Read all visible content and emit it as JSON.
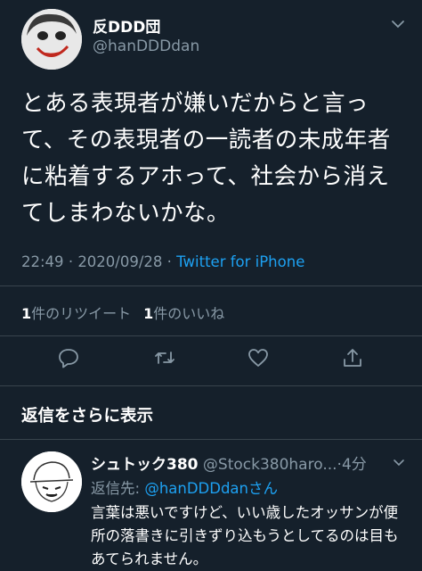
{
  "author": {
    "display_name": "反DDD団",
    "handle": "@hanDDDdan"
  },
  "tweet": {
    "text": "とある表現者が嫌いだからと言って、その表現者の一読者の未成年者に粘着するアホって、社会から消えてしまわないかな。",
    "time": "22:49",
    "date": "2020/09/28",
    "source": "Twitter for iPhone"
  },
  "stats": {
    "retweets_count": "1",
    "retweets_label": "件のリツイート",
    "likes_count": "1",
    "likes_label": "件のいいね"
  },
  "actions": {
    "reply_icon": "reply-icon",
    "retweet_icon": "retweet-icon",
    "like_icon": "heart-icon",
    "share_icon": "share-icon"
  },
  "more_replies_label": "返信をさらに表示",
  "reply": {
    "display_name": "シュトック380",
    "handle": "@Stock380haro...",
    "age": "4分",
    "replying_to_label": "返信先: ",
    "replying_to": "@hanDDDdanさん",
    "text": "言葉は悪いですけど、いい歳したオッサンが便所の落書きに引きずり込もうとしてるのは目もあてられません。"
  },
  "colors": {
    "background": "#15202b",
    "accent": "#1da1f2",
    "secondary_text": "#8899a6",
    "divider": "#38444d"
  }
}
